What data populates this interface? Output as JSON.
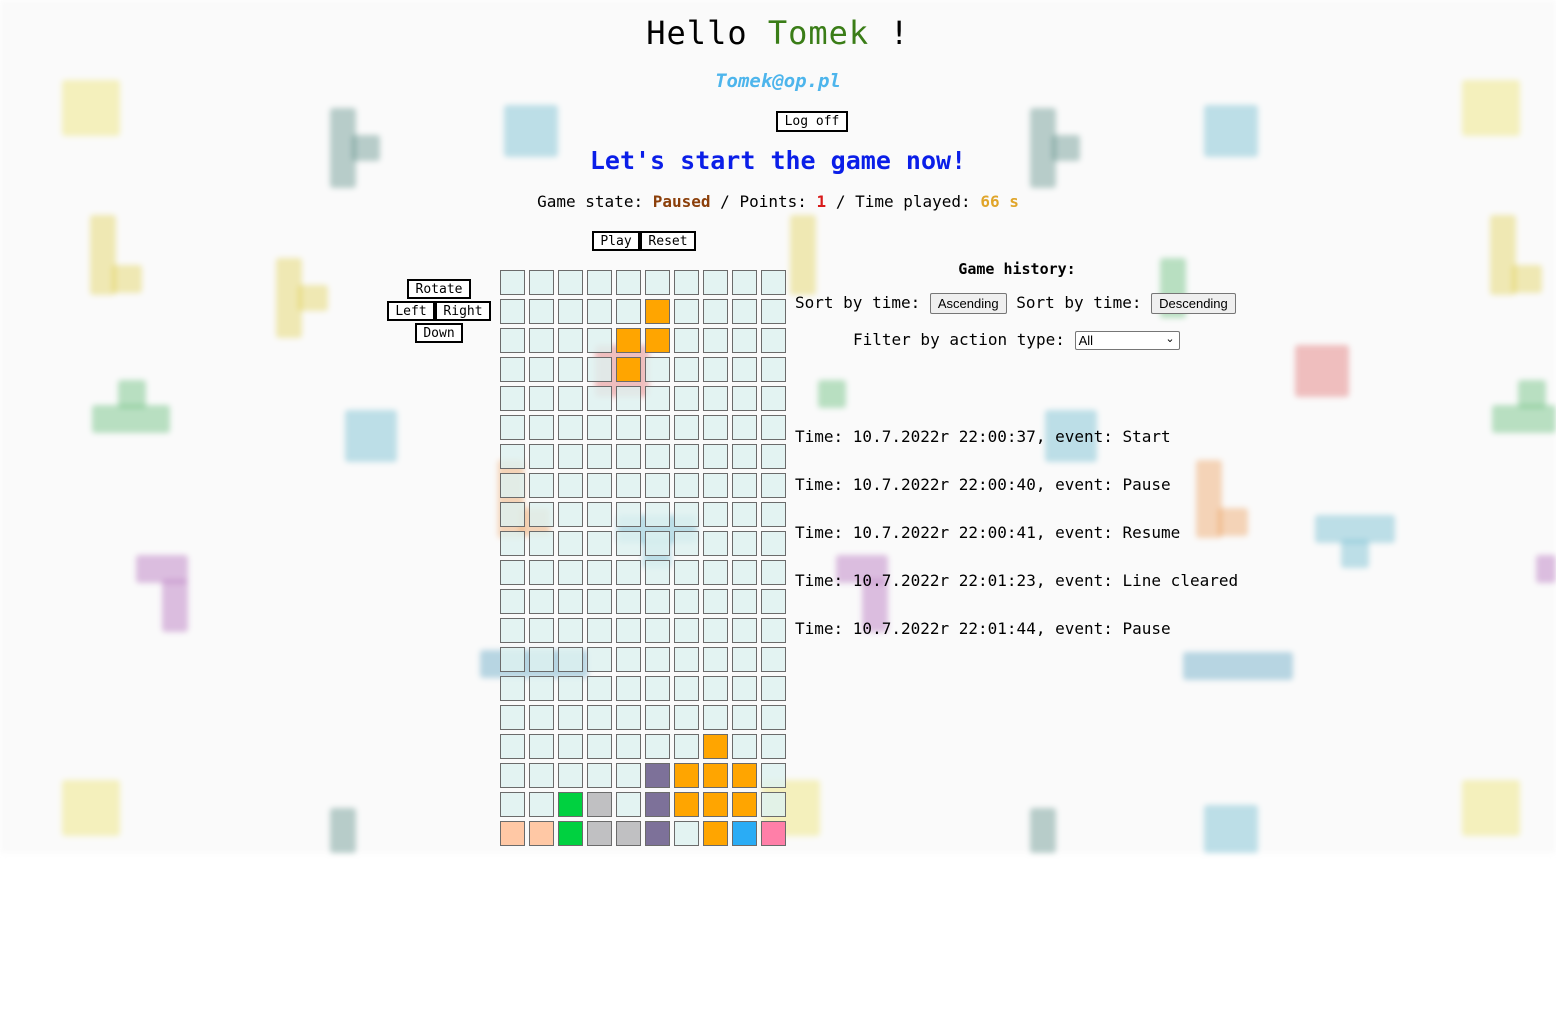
{
  "header": {
    "greeting": "Hello",
    "user_name": "Tomek",
    "exclamation": "!",
    "email": "Tomek@op.pl"
  },
  "account": {
    "logoff_label": "Log off"
  },
  "start_message": "Let's start the game now!",
  "status": {
    "state_label": "Game state:",
    "state_value": "Paused",
    "sep1": "/",
    "points_label": "Points:",
    "points_value": "1",
    "sep2": "/",
    "time_label": "Time played:",
    "time_value": "66 s"
  },
  "controls": {
    "play_label": "Play",
    "reset_label": "Reset",
    "rotate_label": "Rotate",
    "left_label": "Left",
    "right_label": "Right",
    "down_label": "Down"
  },
  "colors": {
    "orange": "#ffa500",
    "purple": "#7d7199",
    "green": "#00d140",
    "gray": "#c0c0c2",
    "peach": "#ffc8a5",
    "blue": "#2aacf5",
    "pink": "#ff7fa8"
  },
  "board": {
    "columns": 10,
    "rows": 20,
    "filled_cells": [
      {
        "row": 1,
        "col": 5,
        "color": "orange"
      },
      {
        "row": 2,
        "col": 4,
        "color": "orange"
      },
      {
        "row": 2,
        "col": 5,
        "color": "orange"
      },
      {
        "row": 3,
        "col": 4,
        "color": "orange"
      },
      {
        "row": 16,
        "col": 7,
        "color": "orange"
      },
      {
        "row": 17,
        "col": 5,
        "color": "purple"
      },
      {
        "row": 17,
        "col": 6,
        "color": "orange"
      },
      {
        "row": 17,
        "col": 7,
        "color": "orange"
      },
      {
        "row": 17,
        "col": 8,
        "color": "orange"
      },
      {
        "row": 18,
        "col": 2,
        "color": "green"
      },
      {
        "row": 18,
        "col": 3,
        "color": "gray"
      },
      {
        "row": 18,
        "col": 5,
        "color": "purple"
      },
      {
        "row": 18,
        "col": 6,
        "color": "orange"
      },
      {
        "row": 18,
        "col": 7,
        "color": "orange"
      },
      {
        "row": 18,
        "col": 8,
        "color": "orange"
      },
      {
        "row": 19,
        "col": 0,
        "color": "peach"
      },
      {
        "row": 19,
        "col": 1,
        "color": "peach"
      },
      {
        "row": 19,
        "col": 2,
        "color": "green"
      },
      {
        "row": 19,
        "col": 3,
        "color": "gray"
      },
      {
        "row": 19,
        "col": 4,
        "color": "gray"
      },
      {
        "row": 19,
        "col": 5,
        "color": "purple"
      },
      {
        "row": 19,
        "col": 7,
        "color": "orange"
      },
      {
        "row": 19,
        "col": 8,
        "color": "blue"
      },
      {
        "row": 19,
        "col": 9,
        "color": "pink"
      }
    ]
  },
  "history": {
    "title": "Game history:",
    "sort_label_1": "Sort by time:",
    "ascending_label": "Ascending",
    "sort_label_2": "Sort by time:",
    "descending_label": "Descending",
    "filter_label": "Filter by action type:",
    "filter_selected": "All",
    "events": [
      "Time: 10.7.2022r 22:00:37, event: Start",
      "Time: 10.7.2022r 22:00:40, event: Pause",
      "Time: 10.7.2022r 22:00:41, event: Resume",
      "Time: 10.7.2022r 22:01:23, event: Line cleared",
      "Time: 10.7.2022r 22:01:44, event: Pause"
    ]
  }
}
